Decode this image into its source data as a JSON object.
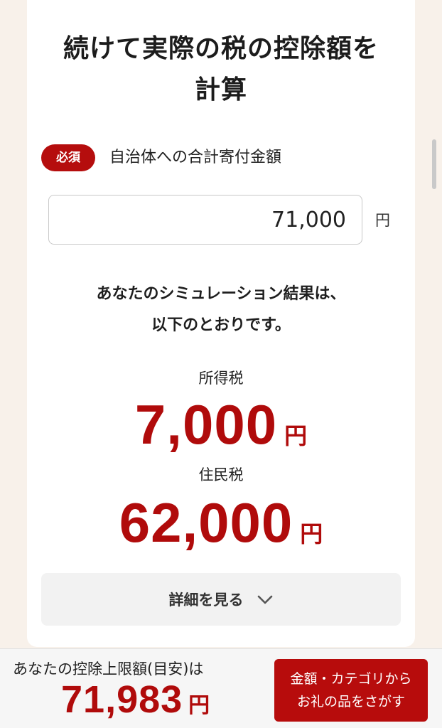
{
  "title_line1": "続けて実際の税の控除額を",
  "title_line2": "計算",
  "donation_field": {
    "required_badge": "必須",
    "label": "自治体への合計寄付金額",
    "value": "71,000",
    "unit": "円"
  },
  "result_intro_line1": "あなたのシミュレーション結果は、",
  "result_intro_line2": "以下のとおりです。",
  "income_tax": {
    "label": "所得税",
    "amount": "7,000",
    "unit": "円"
  },
  "resident_tax": {
    "label": "住民税",
    "amount": "62,000",
    "unit": "円"
  },
  "detail_button": {
    "label": "詳細を見る",
    "icon": "chevron-down-icon"
  },
  "bottom_bar": {
    "limit_label": "あなたの控除上限額(目安)は",
    "limit_amount": "71,983",
    "limit_unit": "円",
    "search_button_line1": "金額・カテゴリから",
    "search_button_line2": "お礼の品をさがす"
  },
  "colors": {
    "accent": "#b00b0b",
    "background": "#f8f1ea"
  }
}
